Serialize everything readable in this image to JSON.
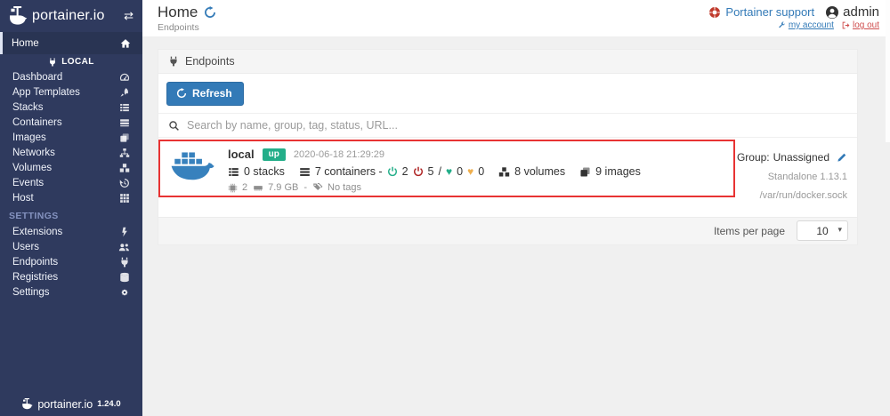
{
  "colors": {
    "sidebar_bg": "#2f3a5e",
    "accent_blue": "#337ab7",
    "status_green": "#23ae89",
    "status_red": "#ae2323",
    "status_orange": "#efaf4e",
    "annotation_red": "#e83333",
    "page_bg": "#f0f0f0"
  },
  "icons": {
    "collapse_glyph": "⇄",
    "caret_glyph": "▾",
    "heart_glyph": "♥"
  },
  "sidebar": {
    "logo_text": "portainer.io",
    "home_label": "Home",
    "local_header": "LOCAL",
    "local_items": [
      {
        "label": "Dashboard",
        "icon": "tachometer"
      },
      {
        "label": "App Templates",
        "icon": "rocket"
      },
      {
        "label": "Stacks",
        "icon": "list"
      },
      {
        "label": "Containers",
        "icon": "server"
      },
      {
        "label": "Images",
        "icon": "clone"
      },
      {
        "label": "Networks",
        "icon": "sitemap"
      },
      {
        "label": "Volumes",
        "icon": "cubes"
      },
      {
        "label": "Events",
        "icon": "history"
      },
      {
        "label": "Host",
        "icon": "grid"
      }
    ],
    "settings_header": "SETTINGS",
    "settings_items": [
      {
        "label": "Extensions",
        "icon": "bolt"
      },
      {
        "label": "Users",
        "icon": "users"
      },
      {
        "label": "Endpoints",
        "icon": "plug"
      },
      {
        "label": "Registries",
        "icon": "database"
      },
      {
        "label": "Settings",
        "icon": "gears"
      }
    ],
    "footer": {
      "logo_text": "portainer.io",
      "version": "1.24.0"
    }
  },
  "header": {
    "title": "Home",
    "breadcrumb": "Endpoints",
    "support_label": "Portainer support",
    "username": "admin",
    "my_account_label": "my account",
    "log_out_label": "log out"
  },
  "panel": {
    "title": "Endpoints",
    "refresh_label": "Refresh",
    "search_placeholder": "Search by name, group, tag, status, URL...",
    "endpoint": {
      "name": "local",
      "status": "up",
      "timestamp": "2020-06-18 21:29:29",
      "stacks": "0 stacks",
      "containers": "7 containers -",
      "running": "2",
      "stopped": "5",
      "slash": "/",
      "healthy": "0",
      "unhealthy": "0",
      "volumes": "8 volumes",
      "images": "9 images",
      "cpu": "2",
      "ram": "7.9 GB",
      "dash": "-",
      "tags": "No tags",
      "group_label": "Group:",
      "group_value": "Unassigned",
      "type": "Standalone 1.13.1",
      "url": "/var/run/docker.sock"
    },
    "pagination": {
      "label": "Items per page",
      "value": "10"
    }
  }
}
